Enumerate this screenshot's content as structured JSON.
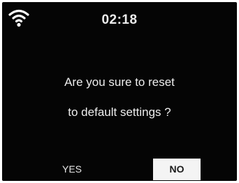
{
  "status_bar": {
    "wifi_icon": "wifi-icon",
    "time": "02:18"
  },
  "dialog": {
    "message_line_1": "Are you sure to reset",
    "message_line_2": "to default settings ?",
    "yes_label": "YES",
    "no_label": "NO",
    "selected": "NO"
  },
  "colors": {
    "screen_background": "#050505",
    "text": "#eeeeee",
    "selected_button_background": "#f4f4f4",
    "selected_button_text": "#1a1a1a"
  }
}
